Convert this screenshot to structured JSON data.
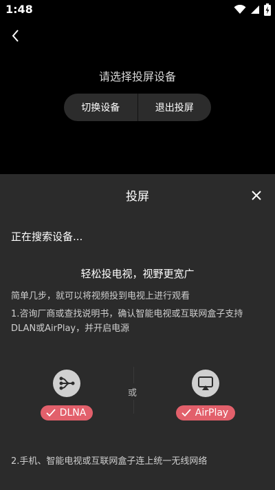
{
  "status_bar": {
    "time": "1:48"
  },
  "header": {
    "prompt": "请选择投屏设备",
    "switch_device_label": "切换设备",
    "exit_cast_label": "退出投屏"
  },
  "panel": {
    "title": "投屏",
    "searching_text": "正在搜索设备...",
    "tip_heading": "轻松投电视，视野更宽广",
    "tip_intro": "简单几步，就可以将视频投到电视上进行观看",
    "step1": "1.咨询厂商或查找说明书，确认智能电视或互联网盒子支持DLAN或AirPlay，并开启电源",
    "or_text": "或",
    "protocols": [
      {
        "name": "DLNA",
        "icon": "dlna-icon"
      },
      {
        "name": "AirPlay",
        "icon": "airplay-icon"
      }
    ],
    "step2": "2.手机、智能电视或互联网盒子连上统一无线网络"
  },
  "colors": {
    "background": "#000000",
    "panel": "#2b2b2b",
    "badge": "#e2606b",
    "button_group": "#2c2c2c"
  }
}
